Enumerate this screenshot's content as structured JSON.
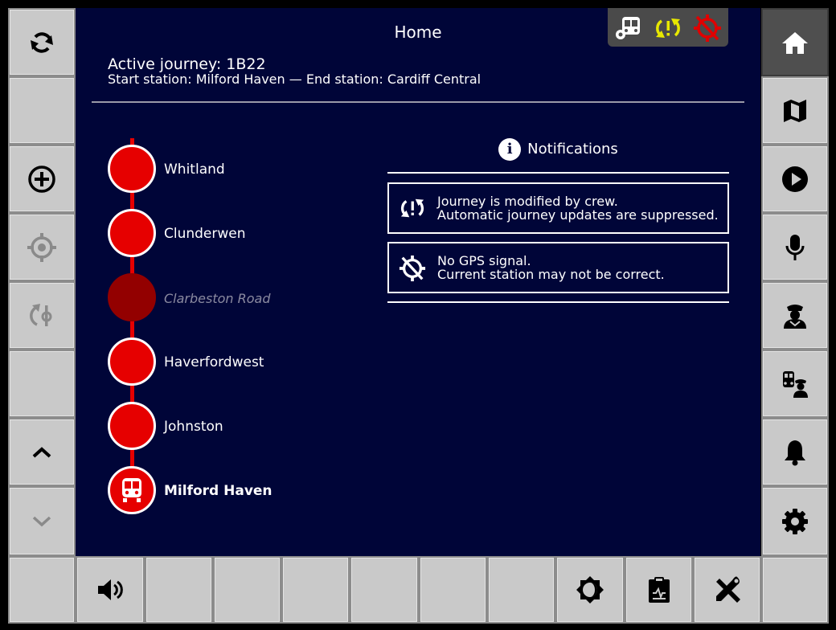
{
  "header": {
    "title": "Home"
  },
  "journey": {
    "active_label": "Active journey: 1B22",
    "route_label": "Start station: Milford Haven — End station: Cardiff Central"
  },
  "stations": [
    {
      "name": "Whitland",
      "state": "upcoming"
    },
    {
      "name": "Clunderwen",
      "state": "upcoming"
    },
    {
      "name": "Clarbeston Road",
      "state": "skipped"
    },
    {
      "name": "Haverfordwest",
      "state": "upcoming"
    },
    {
      "name": "Johnston",
      "state": "upcoming"
    },
    {
      "name": "Milford Haven",
      "state": "current"
    }
  ],
  "notifications": {
    "title": "Notifications",
    "items": [
      {
        "icon": "journey-modified-icon",
        "line1": "Journey is modified by crew.",
        "line2": "Automatic journey updates are suppressed."
      },
      {
        "icon": "no-gps-icon",
        "line1": "No GPS signal.",
        "line2": "Current station may not be correct."
      }
    ]
  },
  "status_icons": [
    "train-settings-icon",
    "journey-modified-icon",
    "no-gps-icon"
  ],
  "left_buttons": [
    "sync-icon",
    "",
    "add-circle-icon",
    "gps-target-icon",
    "route-change-icon",
    "",
    "chevron-up-icon",
    "chevron-down-icon"
  ],
  "right_buttons": [
    "home-icon",
    "map-icon",
    "play-icon",
    "microphone-icon",
    "crew-icon",
    "train-staff-icon",
    "bell-icon",
    "gear-icon"
  ],
  "bottom_buttons": [
    "",
    "speaker-icon",
    "",
    "",
    "",
    "",
    "",
    "",
    "brightness-icon",
    "clipboard-check-icon",
    "tools-icon",
    ""
  ],
  "colors": {
    "panel": "#000538",
    "accent_red": "#e60000",
    "warning_yellow": "#e8e800",
    "button_grey": "#c9c9c9"
  }
}
